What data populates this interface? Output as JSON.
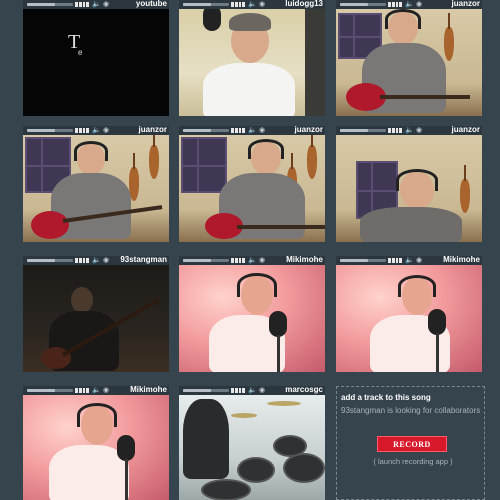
{
  "tiles": [
    {
      "user": "youtube",
      "volume": 0.6
    },
    {
      "user": "luidogg13",
      "volume": 0.6
    },
    {
      "user": "juanzor",
      "volume": 0.6
    },
    {
      "user": "juanzor",
      "volume": 0.6
    },
    {
      "user": "juanzor",
      "volume": 0.6
    },
    {
      "user": "juanzor",
      "volume": 0.6
    },
    {
      "user": "93stangman",
      "volume": 0.6
    },
    {
      "user": "Mikimohe",
      "volume": 0.6
    },
    {
      "user": "Mikimohe",
      "volume": 0.6
    },
    {
      "user": "Mikimohe",
      "volume": 0.6
    },
    {
      "user": "marcosgc",
      "volume": 0.6
    }
  ],
  "youtube_logo": {
    "big": "T",
    "small": "e"
  },
  "add_panel": {
    "title": "add a track to this song",
    "description": "93stangman is looking for collaborators",
    "record_label": "RECORD",
    "launch_label": "( launch recording app )"
  },
  "icons": {
    "speaker": "speaker-icon",
    "headphones": "headphones-icon"
  },
  "colors": {
    "background": "#36444e",
    "record": "#d8192b",
    "title_bar": "#2b363e"
  }
}
